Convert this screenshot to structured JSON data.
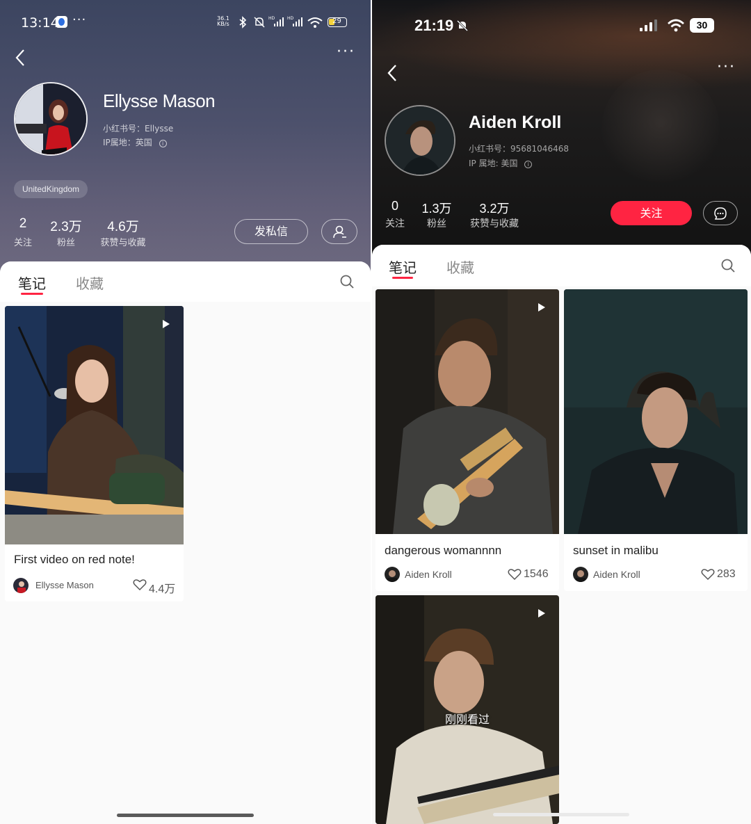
{
  "left": {
    "status": {
      "time": "13:14",
      "net_speed_top": "36.1",
      "net_speed_bottom": "KB/s",
      "battery": "29"
    },
    "profile": {
      "name": "Ellysse Mason",
      "id_line": "小红书号：Ellysse",
      "ip_line": "IP属地：英国",
      "tag": "UnitedKingdom"
    },
    "stats": [
      {
        "value": "2",
        "label": "关注"
      },
      {
        "value": "2.3万",
        "label": "粉丝"
      },
      {
        "value": "4.6万",
        "label": "获赞与收藏"
      }
    ],
    "buttons": {
      "message": "发私信"
    },
    "tabs": [
      {
        "label": "笔记",
        "active": true
      },
      {
        "label": "收藏",
        "active": false
      }
    ],
    "notes": [
      {
        "title": "First video on red note!",
        "author": "Ellysse Mason",
        "likes": "4.4万",
        "video": true
      }
    ]
  },
  "right": {
    "status": {
      "time": "21:19",
      "battery": "30"
    },
    "profile": {
      "name": "Aiden Kroll",
      "id_line": "小红书号：95681046468",
      "ip_line": "IP 属地: 美国"
    },
    "stats": [
      {
        "value": "0",
        "label": "关注"
      },
      {
        "value": "1.3万",
        "label": "粉丝"
      },
      {
        "value": "3.2万",
        "label": "获赞与收藏"
      }
    ],
    "buttons": {
      "follow": "关注"
    },
    "tabs": [
      {
        "label": "笔记",
        "active": true
      },
      {
        "label": "收藏",
        "active": false
      }
    ],
    "notes": [
      {
        "title": "dangerous womannnn",
        "author": "Aiden Kroll",
        "likes": "1546",
        "video": true
      },
      {
        "title": "sunset in malibu",
        "author": "Aiden Kroll",
        "likes": "283",
        "video": false
      },
      {
        "title": "",
        "overlay": "刚刚看过",
        "video": true
      }
    ]
  },
  "colors": {
    "accent_red": "#ff2442",
    "tab_underline": "#ff2442"
  }
}
